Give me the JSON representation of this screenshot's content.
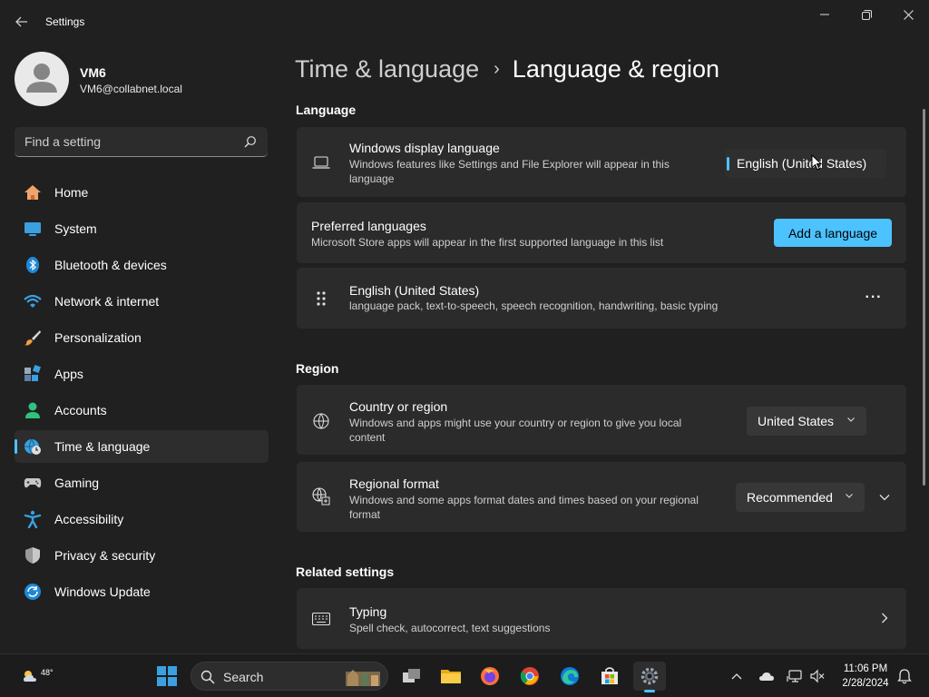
{
  "window": {
    "title": "Settings",
    "back_icon": "back-arrow-icon",
    "controls": [
      "minimize-icon",
      "restore-icon",
      "close-icon"
    ]
  },
  "profile": {
    "name": "VM6",
    "email": "VM6@collabnet.local"
  },
  "search": {
    "placeholder": "Find a setting"
  },
  "sidebar": {
    "items": [
      {
        "label": "Home",
        "icon": "home-icon"
      },
      {
        "label": "System",
        "icon": "system-icon"
      },
      {
        "label": "Bluetooth & devices",
        "icon": "bluetooth-icon"
      },
      {
        "label": "Network & internet",
        "icon": "wifi-icon"
      },
      {
        "label": "Personalization",
        "icon": "brush-icon"
      },
      {
        "label": "Apps",
        "icon": "apps-icon"
      },
      {
        "label": "Accounts",
        "icon": "accounts-icon"
      },
      {
        "label": "Time & language",
        "icon": "globe-clock-icon",
        "active": true
      },
      {
        "label": "Gaming",
        "icon": "gamepad-icon"
      },
      {
        "label": "Accessibility",
        "icon": "accessibility-icon"
      },
      {
        "label": "Privacy & security",
        "icon": "shield-icon"
      },
      {
        "label": "Windows Update",
        "icon": "update-icon"
      }
    ]
  },
  "breadcrumb": {
    "parent": "Time & language",
    "separator": "›",
    "current": "Language & region"
  },
  "language": {
    "section_title": "Language",
    "display_language": {
      "title": "Windows display language",
      "description": "Windows features like Settings and File Explorer will appear in this language",
      "value": "English (United States)"
    },
    "preferred": {
      "title": "Preferred languages",
      "description": "Microsoft Store apps will appear in the first supported language in this list",
      "button": "Add a language"
    },
    "installed": {
      "title": "English (United States)",
      "description": "language pack, text-to-speech, speech recognition, handwriting, basic typing",
      "more": "···"
    }
  },
  "region": {
    "section_title": "Region",
    "country": {
      "title": "Country or region",
      "description": "Windows and apps might use your country or region to give you local content",
      "value": "United States"
    },
    "format": {
      "title": "Regional format",
      "description": "Windows and some apps format dates and times based on your regional format",
      "value": "Recommended"
    }
  },
  "related": {
    "section_title": "Related settings",
    "typing": {
      "title": "Typing",
      "description": "Spell check, autocorrect, text suggestions"
    }
  },
  "taskbar": {
    "weather_temp": "48°",
    "search_label": "Search",
    "time": "11:06 PM",
    "date": "2/28/2024"
  },
  "colors": {
    "accent": "#4cc2ff",
    "background": "#202020",
    "card": "#2b2b2b"
  }
}
